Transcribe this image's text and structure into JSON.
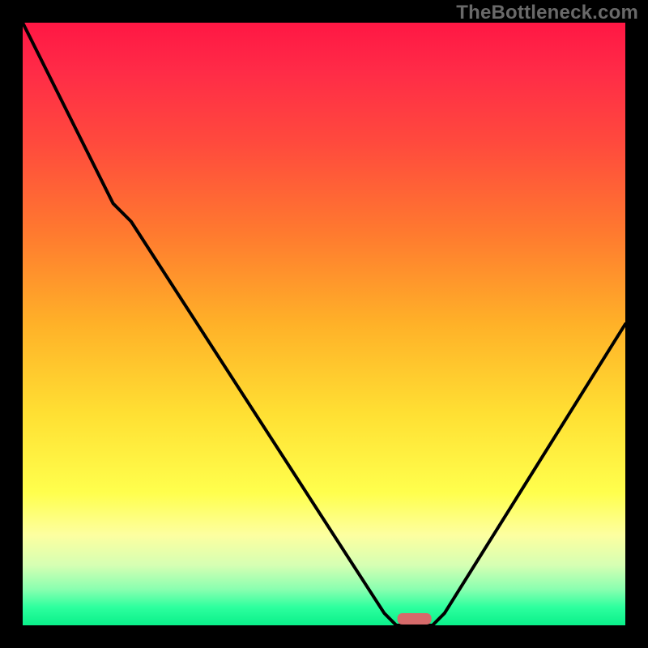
{
  "watermark": "TheBottleneck.com",
  "chart_data": {
    "type": "line",
    "title": "",
    "xlabel": "",
    "ylabel": "",
    "xlim": [
      0,
      100
    ],
    "ylim": [
      0,
      100
    ],
    "grid": false,
    "legend": false,
    "marker": {
      "x": 65,
      "color": "#d66a6a"
    },
    "series": [
      {
        "name": "curve",
        "x": [
          0,
          15,
          18,
          60,
          62,
          68,
          70,
          100
        ],
        "values": [
          100,
          70,
          67,
          2,
          0,
          0,
          2,
          50
        ]
      }
    ],
    "gradient_stops": [
      {
        "offset": 0.0,
        "color": "#ff1744"
      },
      {
        "offset": 0.08,
        "color": "#ff2b47"
      },
      {
        "offset": 0.2,
        "color": "#ff4a3d"
      },
      {
        "offset": 0.35,
        "color": "#ff7a2f"
      },
      {
        "offset": 0.5,
        "color": "#ffb128"
      },
      {
        "offset": 0.65,
        "color": "#ffe033"
      },
      {
        "offset": 0.78,
        "color": "#ffff4d"
      },
      {
        "offset": 0.85,
        "color": "#fdffa0"
      },
      {
        "offset": 0.9,
        "color": "#d6ffb3"
      },
      {
        "offset": 0.94,
        "color": "#8affb0"
      },
      {
        "offset": 0.97,
        "color": "#2dff9e"
      },
      {
        "offset": 1.0,
        "color": "#0af08a"
      }
    ]
  }
}
